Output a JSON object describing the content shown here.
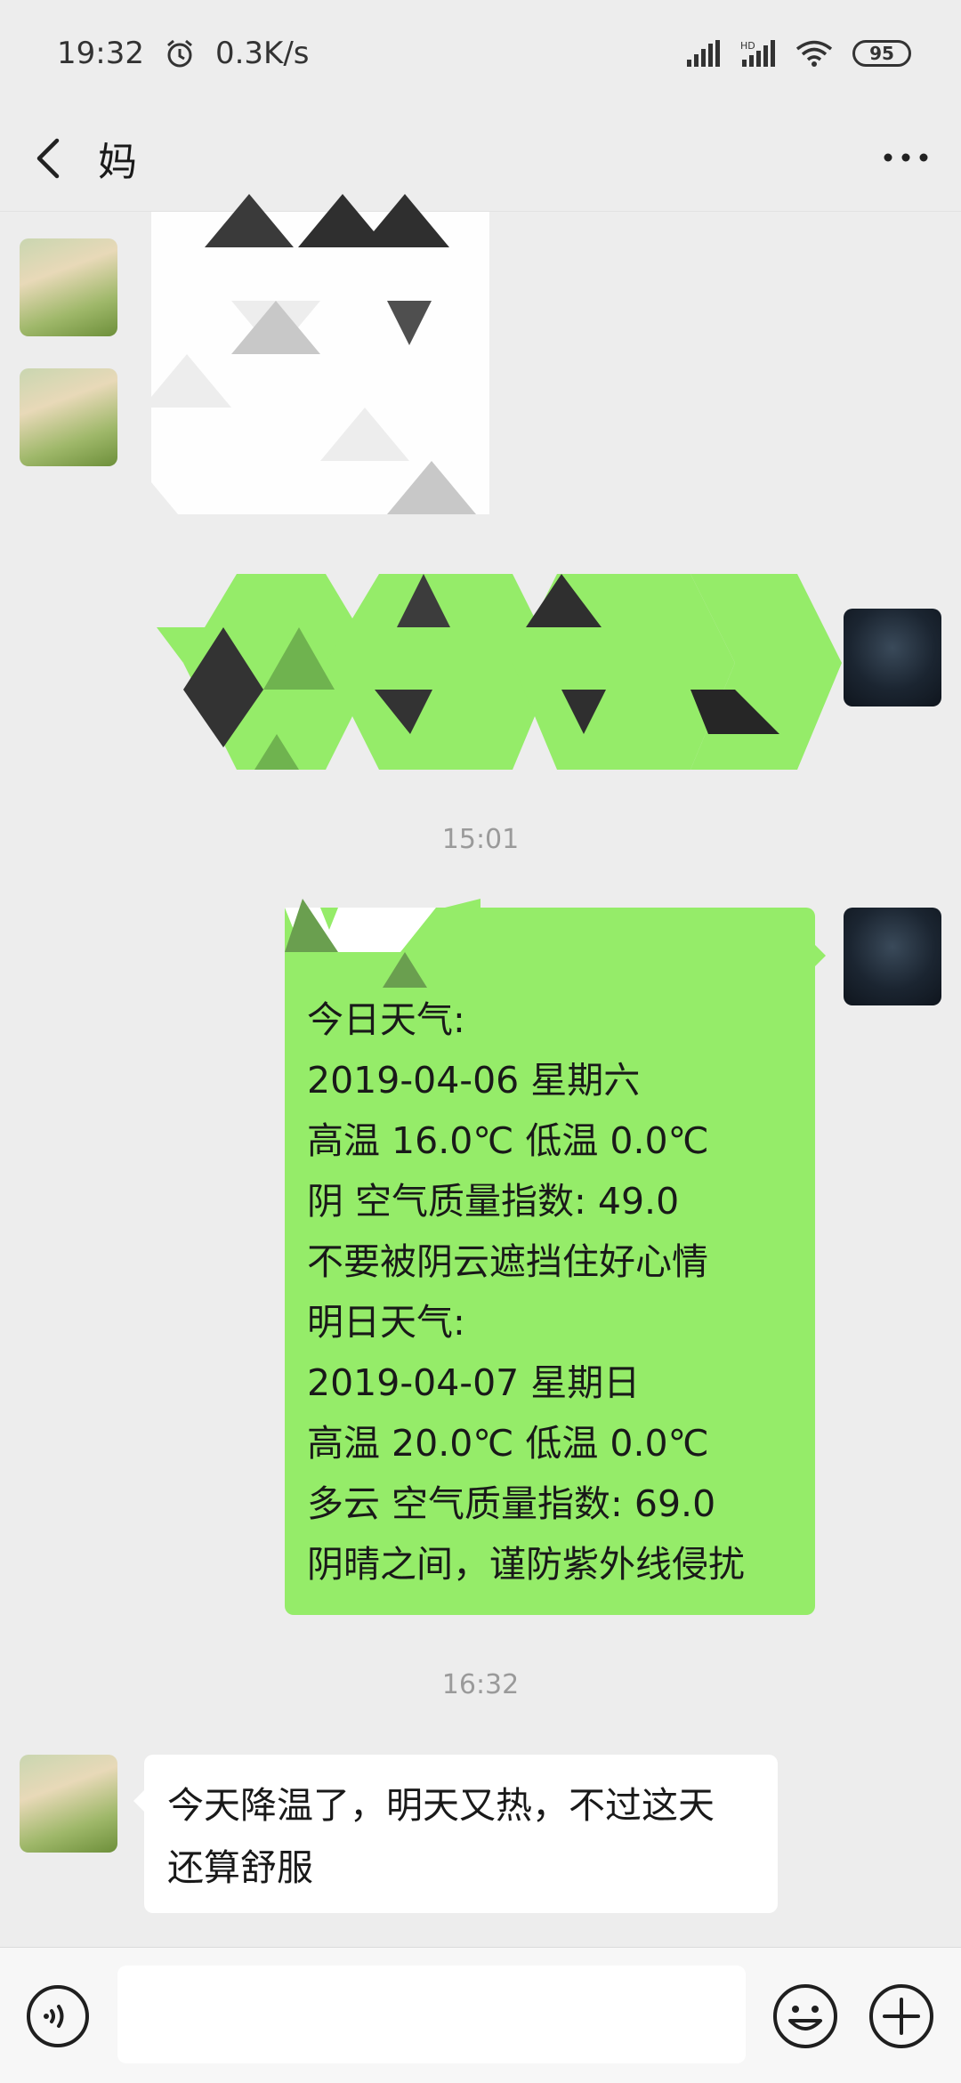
{
  "status_bar": {
    "time": "19:32",
    "speed": "0.3K/s",
    "battery": "95",
    "icons": [
      "alarm-icon",
      "cell-signal-icon",
      "hd-signal-icon",
      "wifi-icon",
      "battery-icon"
    ]
  },
  "header": {
    "title": "妈",
    "icons": [
      "back-arrow-icon",
      "more-icon"
    ]
  },
  "messages": {
    "timestamps": [
      "15:01",
      "16:32"
    ],
    "weather": {
      "lines": [
        "今日天气:",
        "2019-04-06 星期六",
        "高温 16.0℃ 低温 0.0℃",
        "阴 空气质量指数: 49.0",
        "不要被阴云遮挡住好心情",
        "明日天气:",
        "2019-04-07 星期日",
        "高温 20.0℃ 低温 0.0℃",
        "多云 空气质量指数: 69.0",
        "阴晴之间，谨防紫外线侵扰"
      ]
    },
    "reply": {
      "lines": [
        "今天降温了，明天又热，不过这天",
        "还算舒服"
      ]
    }
  },
  "input_bar": {
    "value": "",
    "icons": [
      "voice-icon",
      "emoji-icon",
      "plus-icon"
    ]
  },
  "colors": {
    "background": "#ededed",
    "sent_bubble": "#95ec69",
    "received_bubble": "#ffffff",
    "timestamp": "#9a9a9a"
  }
}
